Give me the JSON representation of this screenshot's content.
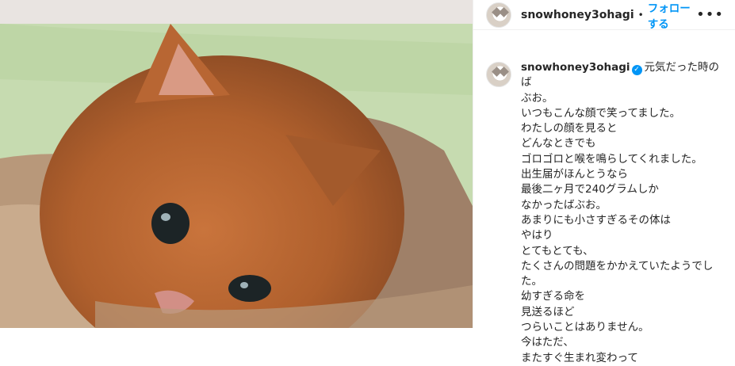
{
  "post": {
    "username": "snowhoney3ohagi",
    "separator": "•",
    "follow_label": "フォローする",
    "more_icon": "more-horizontal-icon",
    "image_alt": "kitten wrapped in towels",
    "caption": {
      "username": "snowhoney3ohagi",
      "verified_icon": "verified-badge-icon",
      "first_line": "元気だった時のば",
      "body": "ぶお。\nいつもこんな顔で笑ってました。\nわたしの顔を見ると\nどんなときでも\nゴロゴロと喉を鳴らしてくれました。\n出生届がほんとうなら\n最後二ヶ月で240グラムしか\nなかったばぶお。\nあまりにも小さすぎるその体は\nやはり\nとてもとても、\nたくさんの問題をかかえていたようでした。\n幼すぎる命を\n見送るほど\nつらいことはありません。\n今はただ、\nまたすぐ生まれ変わって"
    }
  },
  "colors": {
    "accent": "#0095f6",
    "text": "#262626"
  }
}
